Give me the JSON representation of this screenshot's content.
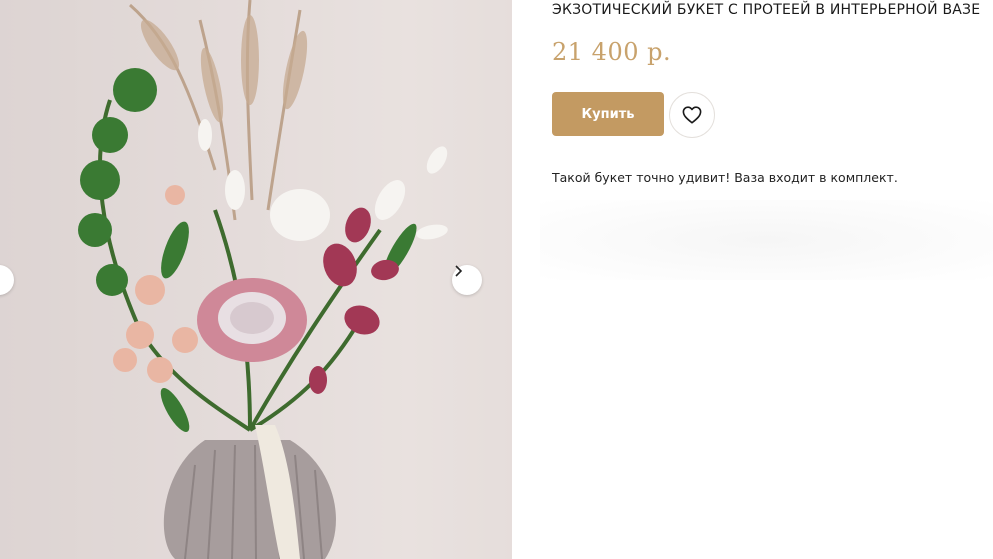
{
  "product": {
    "title": "ЭКЗОТИЧЕСКИЙ БУКЕТ С ПРОТЕЕЙ В ИНТЕРЬЕРНОЙ ВАЗЕ",
    "price": "21 400 р.",
    "buy_label": "Купить",
    "description": "Такой букет точно удивит! Ваза входит в комплект."
  },
  "gallery": {
    "prev_icon": "chevron-left-icon",
    "next_icon": "chevron-right-icon",
    "photo": "bouquet-with-protea-in-vase"
  },
  "icons": {
    "favorite": "heart-icon"
  },
  "colors": {
    "accent": "#c39a62",
    "price": "#c8a26c",
    "text": "#1a1a1a"
  }
}
